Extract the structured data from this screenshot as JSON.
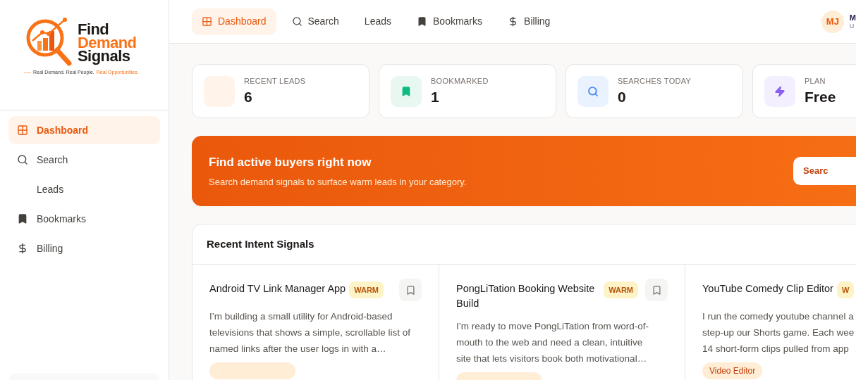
{
  "logo": {
    "line1": "Find",
    "line2": "Demand",
    "line3": "Signals",
    "tagline": "Real Demand. Real People.",
    "tagline_accent": "Real Opportunities."
  },
  "sidebar": {
    "items": [
      {
        "label": "Dashboard",
        "selected": true
      },
      {
        "label": "Search",
        "selected": false
      },
      {
        "label": "Leads",
        "selected": false
      },
      {
        "label": "Bookmarks",
        "selected": false
      },
      {
        "label": "Billing",
        "selected": false
      }
    ]
  },
  "topnav": {
    "items": [
      {
        "label": "Dashboard",
        "selected": true
      },
      {
        "label": "Search",
        "selected": false
      },
      {
        "label": "Leads",
        "selected": false
      },
      {
        "label": "Bookmarks",
        "selected": false
      },
      {
        "label": "Billing",
        "selected": false
      }
    ],
    "user": {
      "initials": "MJ",
      "name": "M",
      "sub": "U"
    }
  },
  "stats": [
    {
      "label": "RECENT LEADS",
      "value": "6"
    },
    {
      "label": "BOOKMARKED",
      "value": "1",
      "color": "#10b981"
    },
    {
      "label": "SEARCHES TODAY",
      "value": "0",
      "color": "#3b82f6"
    },
    {
      "label": "PLAN",
      "value": "Free",
      "color": "#8b5cf6"
    }
  ],
  "banner": {
    "title": "Find active buyers right now",
    "subtitle": "Search demand signals to surface warm leads in your category.",
    "button": "Searc"
  },
  "signals": {
    "title": "Recent Intent Signals",
    "cards": [
      {
        "title": "Android TV Link Manager App",
        "badge": "WARM",
        "description": [
          "I’m building a small utility for Android-based",
          "televisions that shows a simple, scrollable list of",
          "named links after the user logs in with a…"
        ]
      },
      {
        "title": "PongLiTation Booking Website Build",
        "badge": "WARM",
        "description": [
          "I’m ready to move PongLiTation from word-of-",
          "mouth to the web and need a clean, intuitive",
          "site that lets visitors book both motivational…"
        ]
      },
      {
        "title": "YouTube Comedy Clip Editor",
        "badge": "W",
        "description": [
          "I run the comedy youtube channel a",
          "step-up our Shorts game. Each wee",
          "14 short-form clips pulled from app"
        ],
        "tag": "Video Editor"
      }
    ]
  }
}
